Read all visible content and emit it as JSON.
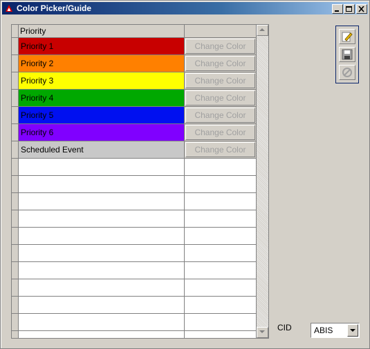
{
  "window": {
    "title": "Color Picker/Guide"
  },
  "table": {
    "header": "Priority",
    "rows": [
      {
        "label": "Priority 1",
        "color": "#c80000",
        "button": "Change Color"
      },
      {
        "label": "Priority 2",
        "color": "#ff8000",
        "button": "Change Color"
      },
      {
        "label": "Priority 3",
        "color": "#ffff00",
        "button": "Change Color"
      },
      {
        "label": "Priority 4",
        "color": "#00a800",
        "button": "Change Color"
      },
      {
        "label": "Priority 5",
        "color": "#0010f0",
        "button": "Change Color"
      },
      {
        "label": "Priority 6",
        "color": "#8000ff",
        "button": "Change Color"
      },
      {
        "label": "Scheduled Event",
        "color": "#c8c8c8",
        "button": "Change Color"
      }
    ],
    "empty_rows": 11
  },
  "toolbar": {
    "icons": [
      "edit-icon",
      "save-icon",
      "cancel-icon"
    ]
  },
  "cid": {
    "label": "CID",
    "value": "ABIS"
  }
}
